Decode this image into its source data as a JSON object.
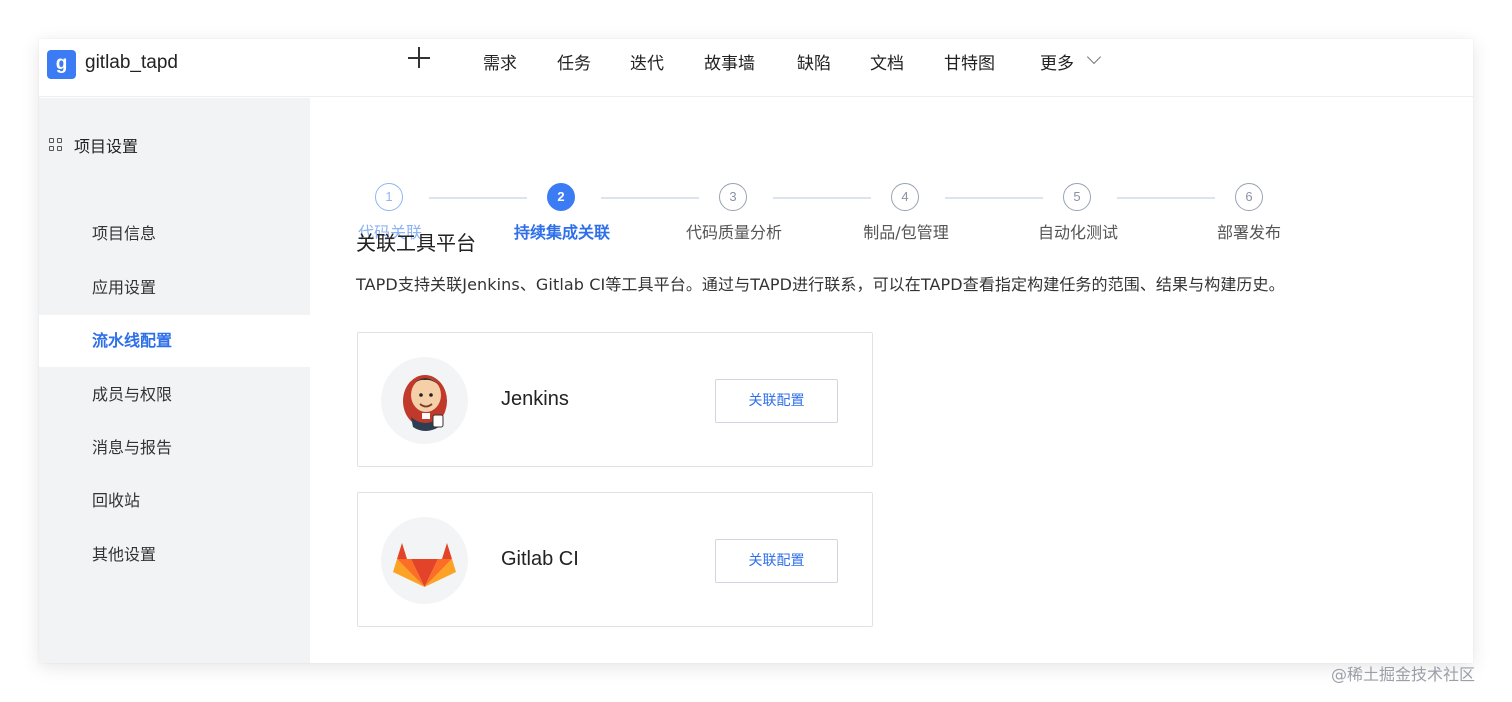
{
  "header": {
    "logo_letter": "g",
    "project_name": "gitlab_tapd",
    "nav": [
      "需求",
      "任务",
      "迭代",
      "故事墙",
      "缺陷",
      "文档",
      "甘特图",
      "更多"
    ]
  },
  "sidebar": {
    "section_title": "项目设置",
    "items": [
      {
        "label": "项目信息",
        "active": false
      },
      {
        "label": "应用设置",
        "active": false
      },
      {
        "label": "流水线配置",
        "active": true
      },
      {
        "label": "成员与权限",
        "active": false
      },
      {
        "label": "消息与报告",
        "active": false
      },
      {
        "label": "回收站",
        "active": false
      },
      {
        "label": "其他设置",
        "active": false
      }
    ]
  },
  "steps": [
    {
      "num": "1",
      "label": "代码关联",
      "state": "done"
    },
    {
      "num": "2",
      "label": "持续集成关联",
      "state": "current"
    },
    {
      "num": "3",
      "label": "代码质量分析",
      "state": "todo"
    },
    {
      "num": "4",
      "label": "制品/包管理",
      "state": "todo"
    },
    {
      "num": "5",
      "label": "自动化测试",
      "state": "todo"
    },
    {
      "num": "6",
      "label": "部署发布",
      "state": "todo"
    }
  ],
  "main": {
    "title": "关联工具平台",
    "description": "TAPD支持关联Jenkins、Gitlab CI等工具平台。通过与TAPD进行联系，可以在TAPD查看指定构建任务的范围、结果与构建历史。",
    "cards": [
      {
        "name": "Jenkins",
        "button": "关联配置",
        "icon": "jenkins-logo-icon"
      },
      {
        "name": "Gitlab CI",
        "button": "关联配置",
        "icon": "gitlab-logo-icon"
      }
    ]
  },
  "watermark": "@稀土掘金技术社区",
  "colors": {
    "accent": "#3b7cf5",
    "sidebar_bg": "#f2f3f5",
    "active_text": "#2f6fea"
  }
}
